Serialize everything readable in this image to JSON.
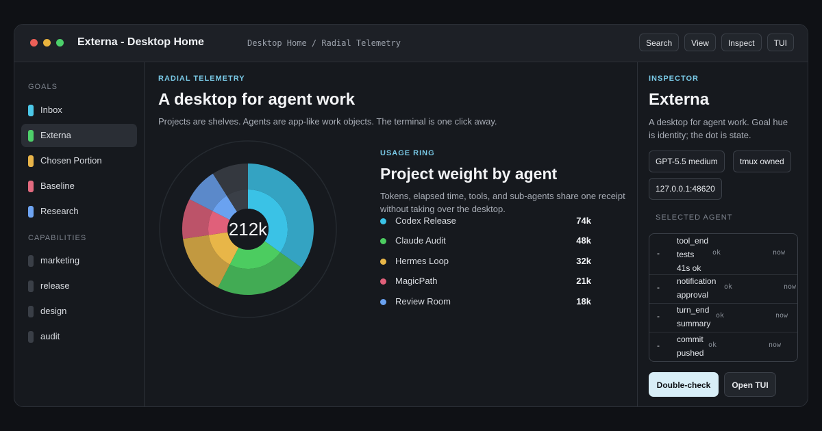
{
  "window": {
    "title": "Externa - Desktop Home",
    "breadcrumb": "Desktop Home / Radial Telemetry"
  },
  "toolbar": [
    "Search",
    "View",
    "Inspect",
    "TUI"
  ],
  "sidebar": {
    "goals_heading": "GOALS",
    "goals": [
      {
        "label": "Inbox",
        "color": "#4cc8e8"
      },
      {
        "label": "Externa",
        "color": "#4ed06a",
        "active": true
      },
      {
        "label": "Chosen Portion",
        "color": "#e8b44a"
      },
      {
        "label": "Baseline",
        "color": "#e26a7f"
      },
      {
        "label": "Research",
        "color": "#6ea4f2"
      }
    ],
    "capabilities_heading": "CAPABILITIES",
    "capabilities": [
      {
        "label": "marketing",
        "color": "#3a3f47"
      },
      {
        "label": "release",
        "color": "#3a3f47"
      },
      {
        "label": "design",
        "color": "#3a3f47"
      },
      {
        "label": "audit",
        "color": "#3a3f47"
      }
    ]
  },
  "main": {
    "eyebrow": "RADIAL TELEMETRY",
    "title": "A desktop for agent work",
    "subtitle": "Projects are shelves. Agents are app-like work objects. The terminal is one click away.",
    "center_value": "212k",
    "usage": {
      "eyebrow": "USAGE RING",
      "title": "Project weight by agent",
      "description": "Tokens, elapsed time, tools, and sub-agents share one receipt without taking over the desktop.",
      "agents": [
        {
          "name": "Codex Release",
          "value": "74k",
          "amount": 74,
          "color": "#3ac2e6"
        },
        {
          "name": "Claude Audit",
          "value": "48k",
          "amount": 48,
          "color": "#4ccc60"
        },
        {
          "name": "Hermes Loop",
          "value": "32k",
          "amount": 32,
          "color": "#e8b648"
        },
        {
          "name": "MagicPath",
          "value": "21k",
          "amount": 21,
          "color": "#e0607a"
        },
        {
          "name": "Review Room",
          "value": "18k",
          "amount": 18,
          "color": "#6aa2f0"
        }
      ],
      "remainder": {
        "amount": 19,
        "color": "#3a3f47"
      }
    }
  },
  "inspector": {
    "eyebrow": "INSPECTOR",
    "title": "Externa",
    "description": "A desktop for agent work. Goal hue is identity; the dot is state.",
    "chips": [
      "GPT-5.5 medium",
      "tmux owned",
      "127.0.0.1:48620"
    ],
    "selected_heading": "SELECTED AGENT",
    "events": [
      {
        "dash": "-",
        "lines": [
          "tool_end",
          "tests",
          "41s ok"
        ],
        "status": "ok",
        "time": "now"
      },
      {
        "dash": "-",
        "lines": [
          "notification",
          "approval"
        ],
        "status": "ok",
        "time": "now"
      },
      {
        "dash": "-",
        "lines": [
          "turn_end",
          "summary"
        ],
        "status": "ok",
        "time": "now"
      },
      {
        "dash": "-",
        "lines": [
          "commit",
          "pushed"
        ],
        "status": "ok",
        "time": "now"
      }
    ],
    "primary_action": "Double-check",
    "secondary_action": "Open TUI"
  }
}
